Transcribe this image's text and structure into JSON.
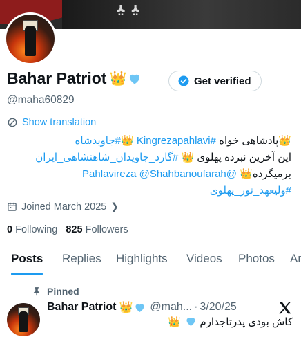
{
  "banner": {
    "script_text": "ﯿ ﯿ"
  },
  "profile": {
    "display_name": "Bahar Patriot",
    "name_emoji": "👑",
    "verify_button": "Get verified",
    "handle": "@maha60829",
    "show_translation": "Show translation",
    "bio": {
      "line1_text": "پادشاهی خواه ",
      "line1_tag1": "#Kingrezapahlavi",
      "line1_tag2": "#جاویدشاه",
      "line2_tag": "#گارد_جاویدان_شاهنشاهی_ایران",
      "line2_text": " این آخرین نبرده پهلوی",
      "line3_text": "برمیگرده",
      "line3_tag1": "@Shahbanoufarah",
      "line3_tag2": "@Pahlavireza",
      "line4_tag": "#ولیعهد_نور_پهلوی",
      "crown": "👑"
    },
    "joined": "Joined March 2025",
    "following_count": "0",
    "following_label": "Following",
    "followers_count": "825",
    "followers_label": "Followers"
  },
  "tabs": [
    "Posts",
    "Replies",
    "Highlights",
    "Videos",
    "Photos",
    "Ar"
  ],
  "pinned_post": {
    "pinned_label": "Pinned",
    "author": "Bahar Patriot",
    "crown": "👑",
    "handle_trunc": "@mah...",
    "dot": "·",
    "date": "3/20/25",
    "text": "کاش بودی پدرتاجدارم",
    "text_emoji": "👑"
  },
  "colors": {
    "accent": "#1d9bf0",
    "text": "#0f1419",
    "muted": "#536471",
    "heart": "#6ec6f5"
  }
}
